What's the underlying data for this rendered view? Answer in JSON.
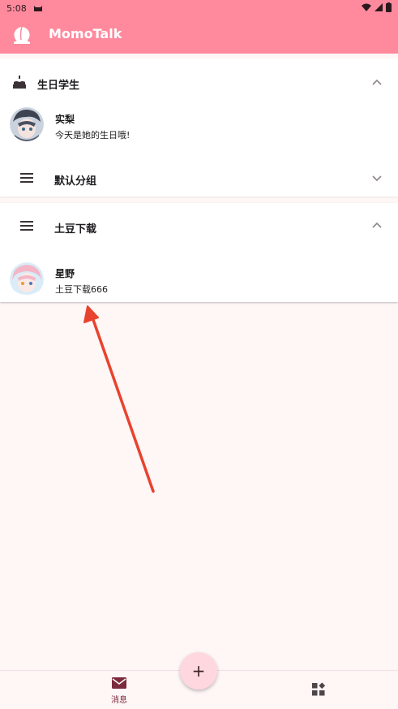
{
  "status_bar": {
    "time": "5:08"
  },
  "app_bar": {
    "title": "MomoTalk"
  },
  "groups": [
    {
      "label": "生日学生",
      "expanded": true,
      "icon": "cake-icon",
      "contacts": [
        {
          "name": "实梨",
          "message": "今天是她的生日哦!"
        }
      ]
    },
    {
      "label": "默认分组",
      "expanded": false,
      "icon": "menu-icon",
      "contacts": []
    },
    {
      "label": "土豆下载",
      "expanded": true,
      "icon": "menu-icon",
      "contacts": [
        {
          "name": "星野",
          "message": "土豆下载666"
        }
      ]
    }
  ],
  "bottom_nav": {
    "items": [
      {
        "label": "消息",
        "icon": "mail-icon",
        "active": true
      },
      {
        "label": "",
        "icon": "apps-icon",
        "active": false
      }
    ]
  },
  "fab": {
    "icon": "plus-icon",
    "symbol": "+"
  },
  "colors": {
    "primary": "#ff8a9e",
    "background": "#fff6f6",
    "annotation_arrow": "#e8432e"
  }
}
